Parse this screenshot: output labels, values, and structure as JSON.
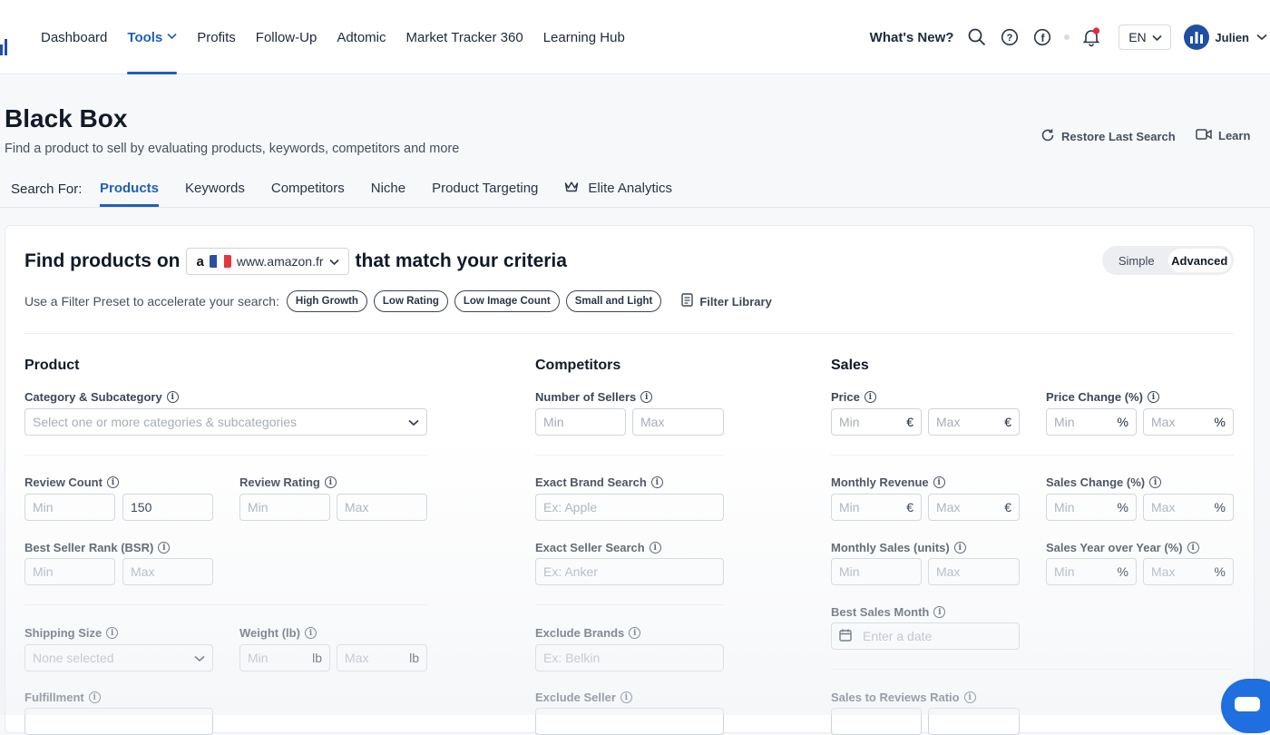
{
  "nav": {
    "items": [
      {
        "label": "Dashboard"
      },
      {
        "label": "Tools"
      },
      {
        "label": "Profits"
      },
      {
        "label": "Follow-Up"
      },
      {
        "label": "Adtomic"
      },
      {
        "label": "Market Tracker 360"
      },
      {
        "label": "Learning Hub"
      }
    ],
    "active": "Tools",
    "whats_new": "What's New?",
    "language": "EN",
    "user": "Julien"
  },
  "header": {
    "title": "Black Box",
    "subtitle": "Find a product to sell by evaluating products, keywords, competitors and more",
    "restore": "Restore Last Search",
    "learn": "Learn"
  },
  "search": {
    "label": "Search For:",
    "tabs": [
      "Products",
      "Keywords",
      "Competitors",
      "Niche",
      "Product Targeting",
      "Elite Analytics"
    ],
    "active_tab": "Products"
  },
  "criteria": {
    "prefix": "Find products on",
    "marketplace": "www.amazon.fr",
    "suffix": "that match your criteria",
    "mode_simple": "Simple",
    "mode_advanced": "Advanced",
    "mode_selected": "Advanced"
  },
  "presets": {
    "label": "Use a Filter Preset to accelerate your search:",
    "chips": [
      "High Growth",
      "Low Rating",
      "Low Image Count",
      "Small and Light"
    ],
    "library": "Filter Library"
  },
  "product": {
    "title": "Product",
    "category_label": "Category & Subcategory",
    "category_placeholder": "Select one or more categories & subcategories",
    "review_count_label": "Review Count",
    "review_count_min": "Min",
    "review_count_value": "150",
    "review_rating_label": "Review Rating",
    "bsr_label": "Best Seller Rank (BSR)",
    "shipping_label": "Shipping Size",
    "shipping_placeholder": "None selected",
    "weight_label": "Weight (lb)",
    "weight_unit": "lb",
    "fulfillment_label": "Fulfillment",
    "min": "Min",
    "max": "Max"
  },
  "competitors": {
    "title": "Competitors",
    "sellers_label": "Number of Sellers",
    "brand_label": "Exact Brand Search",
    "brand_placeholder": "Ex: Apple",
    "seller_label": "Exact Seller Search",
    "seller_placeholder": "Ex: Anker",
    "exclude_brands_label": "Exclude Brands",
    "exclude_brands_placeholder": "Ex: Belkin",
    "exclude_seller_label": "Exclude Seller"
  },
  "sales": {
    "title": "Sales",
    "price_label": "Price",
    "price_change_label": "Price Change (%)",
    "revenue_label": "Monthly Revenue",
    "sales_change_label": "Sales Change (%)",
    "units_label": "Monthly Sales (units)",
    "yoy_label": "Sales Year over Year (%)",
    "best_month_label": "Best Sales Month",
    "best_month_placeholder": "Enter a date",
    "ratio_label": "Sales to Reviews Ratio",
    "currency": "€",
    "percent": "%"
  },
  "colors": {
    "accent": "#1f5fb8",
    "brand": "#1f4fa3"
  }
}
